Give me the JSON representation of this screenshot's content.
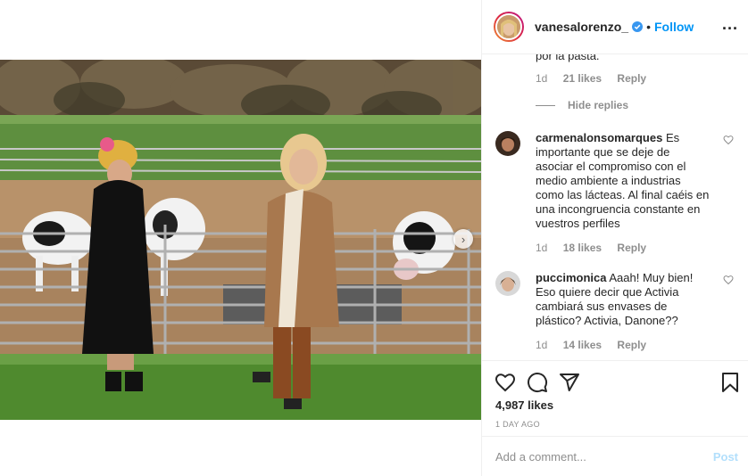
{
  "post": {
    "username": "vanesalorenzo_",
    "dot": "•",
    "follow_label": "Follow",
    "more_label": "...",
    "likes": "4,987 likes",
    "time": "1 DAY AGO"
  },
  "comments": {
    "prev_text_tail": "por la pasta.",
    "prev_meta": {
      "time": "1d",
      "likes": "21 likes",
      "reply": "Reply"
    },
    "hide_replies": "Hide replies",
    "items": [
      {
        "username": "carmenalonsomarques",
        "text": " Es importante que se deje de asociar el compromiso con el medio ambiente a industrias como las lácteas. Al final caéis en una incongruencia constante en vuestros perfiles",
        "time": "1d",
        "likes": "18 likes",
        "reply": "Reply"
      },
      {
        "username": "puccimonica",
        "text": " Aaah! Muy bien! Eso quiere decir que Activia cambiará sus envases de plástico? Activia, Danone??",
        "time": "1d",
        "likes": "14 likes",
        "reply": "Reply"
      }
    ]
  },
  "composer": {
    "placeholder": "Add a comment...",
    "post_label": "Post"
  },
  "colors": {
    "link_blue": "#0095f6",
    "post_disabled": "#b2dffc",
    "muted": "#8e8e8e"
  },
  "icons": [
    "verified-badge-icon",
    "more-options-icon",
    "heart-icon",
    "comment-icon",
    "share-icon",
    "bookmark-icon",
    "chevron-right-icon"
  ]
}
